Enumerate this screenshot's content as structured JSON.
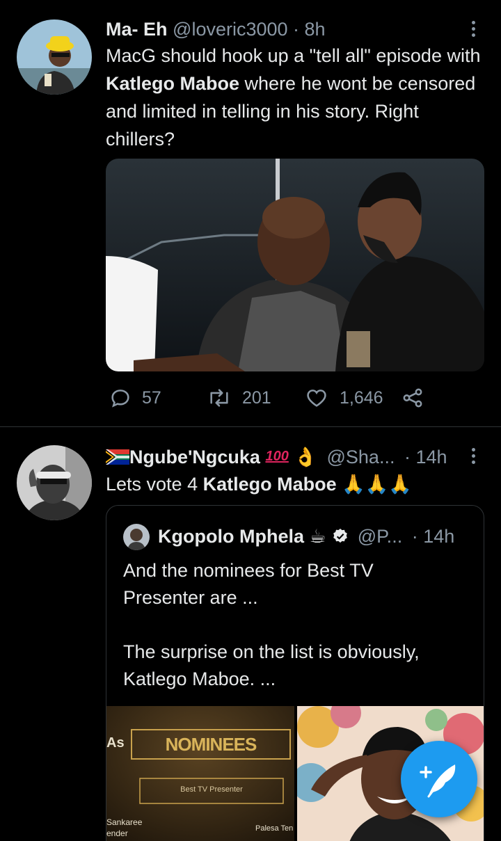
{
  "colors": {
    "background": "#000000",
    "accent": "#1d9bf0",
    "muted": "#8b98a5",
    "text": "#e7e9ea"
  },
  "tweet1": {
    "display_name": "Ma- Eh",
    "handle": "@loveric3000",
    "time": "· 8h",
    "text_before": "MacG should hook up a \"tell all\" episode with ",
    "text_bold": "Katlego Maboe",
    "text_after": " where he wont be censored and limited in telling in his story. Right chillers?",
    "replies": "57",
    "retweets": "201",
    "likes": "1,646"
  },
  "tweet2": {
    "display_name": "Ngube'Ngcuka",
    "name_emoji": "👌",
    "handle": "@Sha...",
    "time": "· 14h",
    "text_before": "Lets vote 4 ",
    "text_bold": "Katlego Maboe",
    "text_emoji": "🙏🙏🙏",
    "quote": {
      "display_name": "Kgopolo Mphela",
      "name_emoji": "☕",
      "handle": "@P...",
      "time": "· 14h",
      "line1": "And the nominees for Best TV",
      "line2": "Presenter are ...",
      "line3": "The surprise on the list is obviously,",
      "line4": "Katlego Maboe. ...",
      "media": {
        "side_label": "As",
        "nominees_label": "NOMINEES",
        "category_label": "Best TV Presenter",
        "left_name_1": "Sankaree",
        "left_name_2": "ender",
        "right_name": "Palesa Ten"
      }
    }
  },
  "fab": {
    "icon": "compose-feather-icon"
  }
}
